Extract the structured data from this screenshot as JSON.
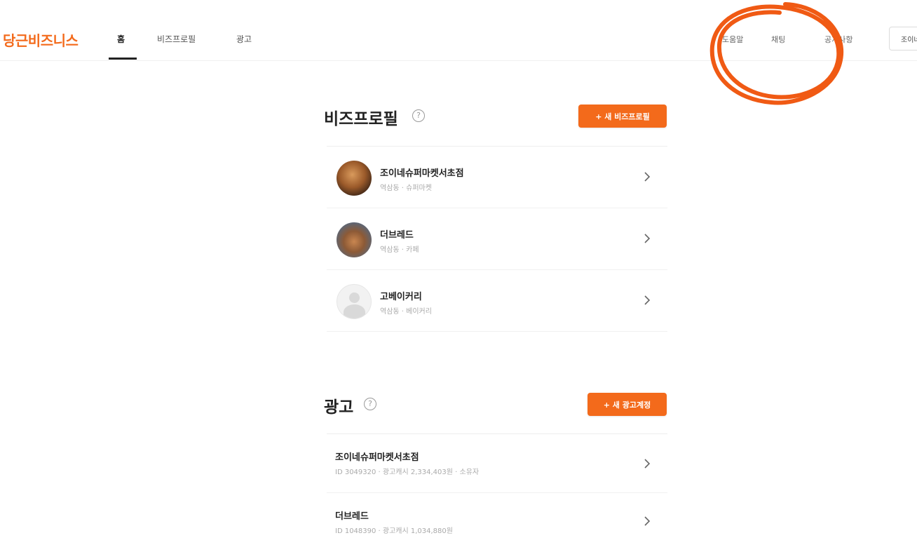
{
  "header": {
    "logo": "당근비즈니스",
    "tabs": [
      {
        "label": "홈",
        "active": true
      },
      {
        "label": "비즈프로필",
        "active": false
      },
      {
        "label": "광고",
        "active": false
      }
    ],
    "right_links": [
      "도움말",
      "채팅",
      "공지사항"
    ],
    "user_label": "조이네",
    "annotation_color": "#f05a14"
  },
  "bizprofile": {
    "title": "비즈프로필",
    "help": "?",
    "new_button": "+ 새 비즈프로필",
    "items": [
      {
        "name": "조이네슈퍼마켓서초점",
        "meta": "역삼동 · 슈퍼마켓",
        "avatar": "store-photo"
      },
      {
        "name": "더브레드",
        "meta": "역삼동 · 카페",
        "avatar": "bread-photo"
      },
      {
        "name": "고베이커리",
        "meta": "역삼동 · 베이커리",
        "avatar": "default-avatar"
      }
    ]
  },
  "ads": {
    "title": "광고",
    "help": "?",
    "new_button": "+ 새 광고계정",
    "items": [
      {
        "name": "조이네슈퍼마켓서초점",
        "meta": "ID 3049320 · 광고캐시 2,334,403원 · 소유자"
      },
      {
        "name": "더브레드",
        "meta": "ID 1048390 · 광고캐시 1,034,880원"
      }
    ]
  },
  "colors": {
    "brand": "#f36a1b",
    "text": "#222222",
    "muted": "#aaaaaa"
  }
}
